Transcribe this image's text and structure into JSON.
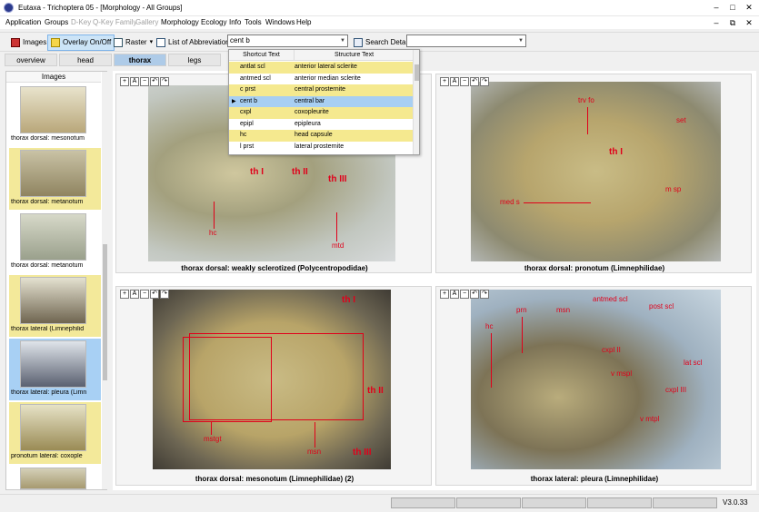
{
  "window": {
    "title": "Eutaxa - Trichoptera 05 - [Morphology - All Groups]",
    "controls": [
      "–",
      "□",
      "✕"
    ],
    "child_controls": [
      "–",
      "⧉",
      "✕"
    ]
  },
  "menu": [
    "Application",
    "Groups",
    "D-Key",
    "Q-Key Family",
    "Gallery",
    "Morphology",
    "Ecology",
    "Info",
    "Tools",
    "Windows",
    "Help"
  ],
  "menu_disabled": [
    false,
    false,
    true,
    true,
    true,
    false,
    false,
    false,
    false,
    false,
    false
  ],
  "toolbar": {
    "images_label": "Images",
    "overlay_label": "Overlay On/Off",
    "raster_label": "Raster",
    "raster_arrow": "▾",
    "abbrev_label": "List of Abbreviations",
    "abbrev_value": "cent b",
    "search_label": "Search Details",
    "search_value": ""
  },
  "tabs": [
    "overview",
    "head",
    "thorax",
    "legs"
  ],
  "selected_tab": "thorax",
  "sidebar": {
    "header": "Images",
    "items": [
      {
        "caption": "thorax  dorsal: mesonotum",
        "style": "plain"
      },
      {
        "caption": "thorax  dorsal: metanotum",
        "style": "yel"
      },
      {
        "caption": "thorax  dorsal: metanotum",
        "style": "plain"
      },
      {
        "caption": "thorax  lateral (Limnephilid",
        "style": "yel"
      },
      {
        "caption": "thorax  lateral: pleura (Limn",
        "style": "blu"
      },
      {
        "caption": "pronotum  lateral: coxople",
        "style": "yel"
      },
      {
        "caption": "",
        "style": "plain"
      }
    ]
  },
  "dropdown": {
    "col1": "Shortcut Text",
    "col2": "Structure Text",
    "rows": [
      {
        "short": "antlat scl",
        "text": "anterior lateral sclerite",
        "style": "yel"
      },
      {
        "short": "antmed scl",
        "text": "anterior median sclerite",
        "style": ""
      },
      {
        "short": "c prst",
        "text": "central prosternite",
        "style": "yel"
      },
      {
        "short": "cent b",
        "text": "central bar",
        "style": "sel"
      },
      {
        "short": "cxpl",
        "text": "coxopleurite",
        "style": "yel"
      },
      {
        "short": "epipl",
        "text": "epipleura",
        "style": ""
      },
      {
        "short": "hc",
        "text": "head capsule",
        "style": "yel"
      },
      {
        "short": "l prst",
        "text": "lateral prosternite",
        "style": ""
      }
    ]
  },
  "panels": {
    "tl": {
      "caption": "thorax dorsal: weakly sclerotized (Polycentropodidae)",
      "labels": [
        "th I",
        "th II",
        "th III",
        "hc",
        "mtd"
      ]
    },
    "tr": {
      "caption": "thorax dorsal: pronotum (Limnephilidae)",
      "labels": [
        "trv fo",
        "set",
        "th I",
        "m sp",
        "med s"
      ]
    },
    "bl": {
      "caption": "thorax dorsal: mesonotum (Limnephilidae) (2)",
      "labels": [
        "th I",
        "th II",
        "th III",
        "mstgt",
        "msn"
      ]
    },
    "br": {
      "caption": "thorax lateral: pleura (Limnephilidae)",
      "labels": [
        "antmed scl",
        "post scl",
        "hc",
        "prn",
        "msn",
        "cxpl II",
        "lat scl",
        "v mspl",
        "cxpl III",
        "v mtpl"
      ]
    }
  },
  "panel_tool_icons": [
    "+",
    "A",
    "−",
    "↶",
    "↷"
  ],
  "status": {
    "version": "V3.0.33"
  },
  "colors": {
    "accent_label": "#e0001a",
    "selected_tab": "#aecbe8",
    "highlight_yellow": "#f3e99a",
    "highlight_blue": "#a8d0f4"
  }
}
